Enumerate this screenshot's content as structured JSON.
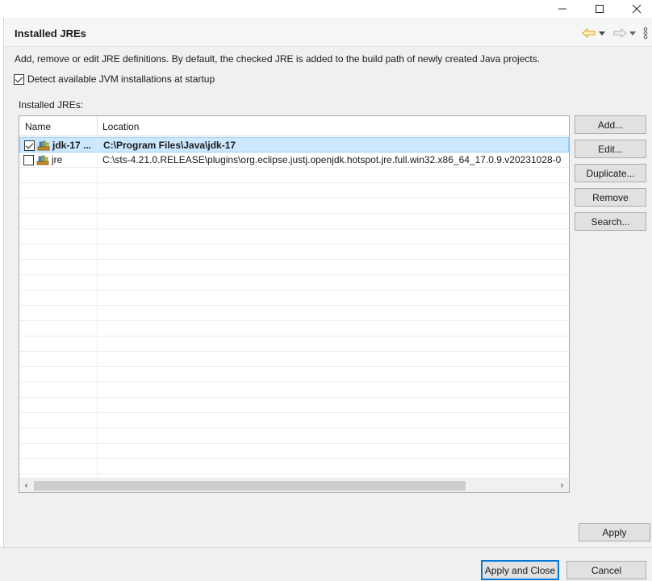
{
  "window": {
    "controls": {
      "minimize_icon": "minimize-icon",
      "maximize_icon": "maximize-icon",
      "close_icon": "close-icon"
    }
  },
  "header": {
    "title": "Installed JREs",
    "icons": [
      "back-arrow-icon",
      "dropdown-icon",
      "forward-arrow-icon",
      "dropdown-icon",
      "view-menu-icon"
    ]
  },
  "description": "Add, remove or edit JRE definitions. By default, the checked JRE is added to the build path of newly created Java projects.",
  "detect": {
    "label": "Detect available JVM installations at startup",
    "checked": true
  },
  "installed_label": "Installed JREs:",
  "table": {
    "columns": [
      "Name",
      "Location"
    ],
    "rows": [
      {
        "checked": true,
        "name": "jdk-17 ...",
        "location": "C:\\Program Files\\Java\\jdk-17",
        "selected": true
      },
      {
        "checked": false,
        "name": "jre",
        "location": "C:\\sts-4.21.0.RELEASE\\plugins\\org.eclipse.justj.openjdk.hotspot.jre.full.win32.x86_64_17.0.9.v20231028-0",
        "selected": false
      }
    ],
    "scroll_left_icon": "‹",
    "scroll_right_icon": "›"
  },
  "buttons": {
    "add": "Add...",
    "edit": "Edit...",
    "duplicate": "Duplicate...",
    "remove": "Remove",
    "search": "Search...",
    "apply": "Apply",
    "apply_and_close": "Apply and Close",
    "cancel": "Cancel"
  },
  "colors": {
    "selection": "#cce8ff",
    "accent": "#0078d7",
    "back_arrow": "#e8a000"
  }
}
